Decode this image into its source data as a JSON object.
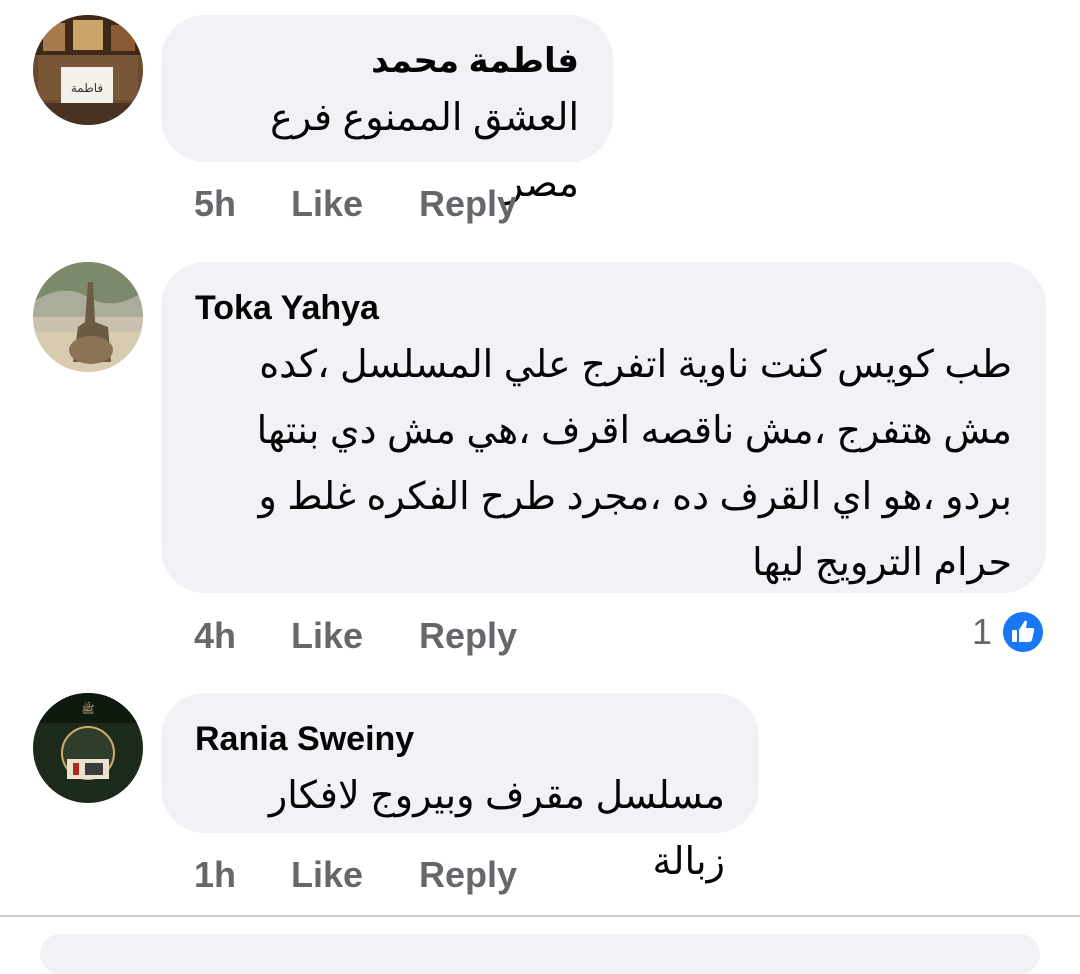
{
  "comments": [
    {
      "author": "فاطمة محمد",
      "text": "العشق الممنوع فرع مصر",
      "time": "5h",
      "like_label": "Like",
      "reply_label": "Reply",
      "reaction_count": ""
    },
    {
      "author": "Toka Yahya",
      "text": "طب كويس كنت ناوية اتفرج علي المسلسل ،كده مش هتفرج ،مش ناقصه اقرف ،هي مش دي بنتها بردو ،هو اي القرف ده ،مجرد طرح الفكره غلط و حرام الترويج ليها",
      "time": "4h",
      "like_label": "Like",
      "reply_label": "Reply",
      "reaction_count": "1"
    },
    {
      "author": "Rania Sweiny",
      "text": "مسلسل مقرف وبيروج لافكار زبالة",
      "time": "1h",
      "like_label": "Like",
      "reply_label": "Reply",
      "reaction_count": ""
    }
  ],
  "colors": {
    "bubble": "#f0f2f5",
    "meta_text": "#65676b",
    "like_blue": "#1877f2"
  },
  "icons": {
    "reaction": "like-thumb-icon"
  }
}
